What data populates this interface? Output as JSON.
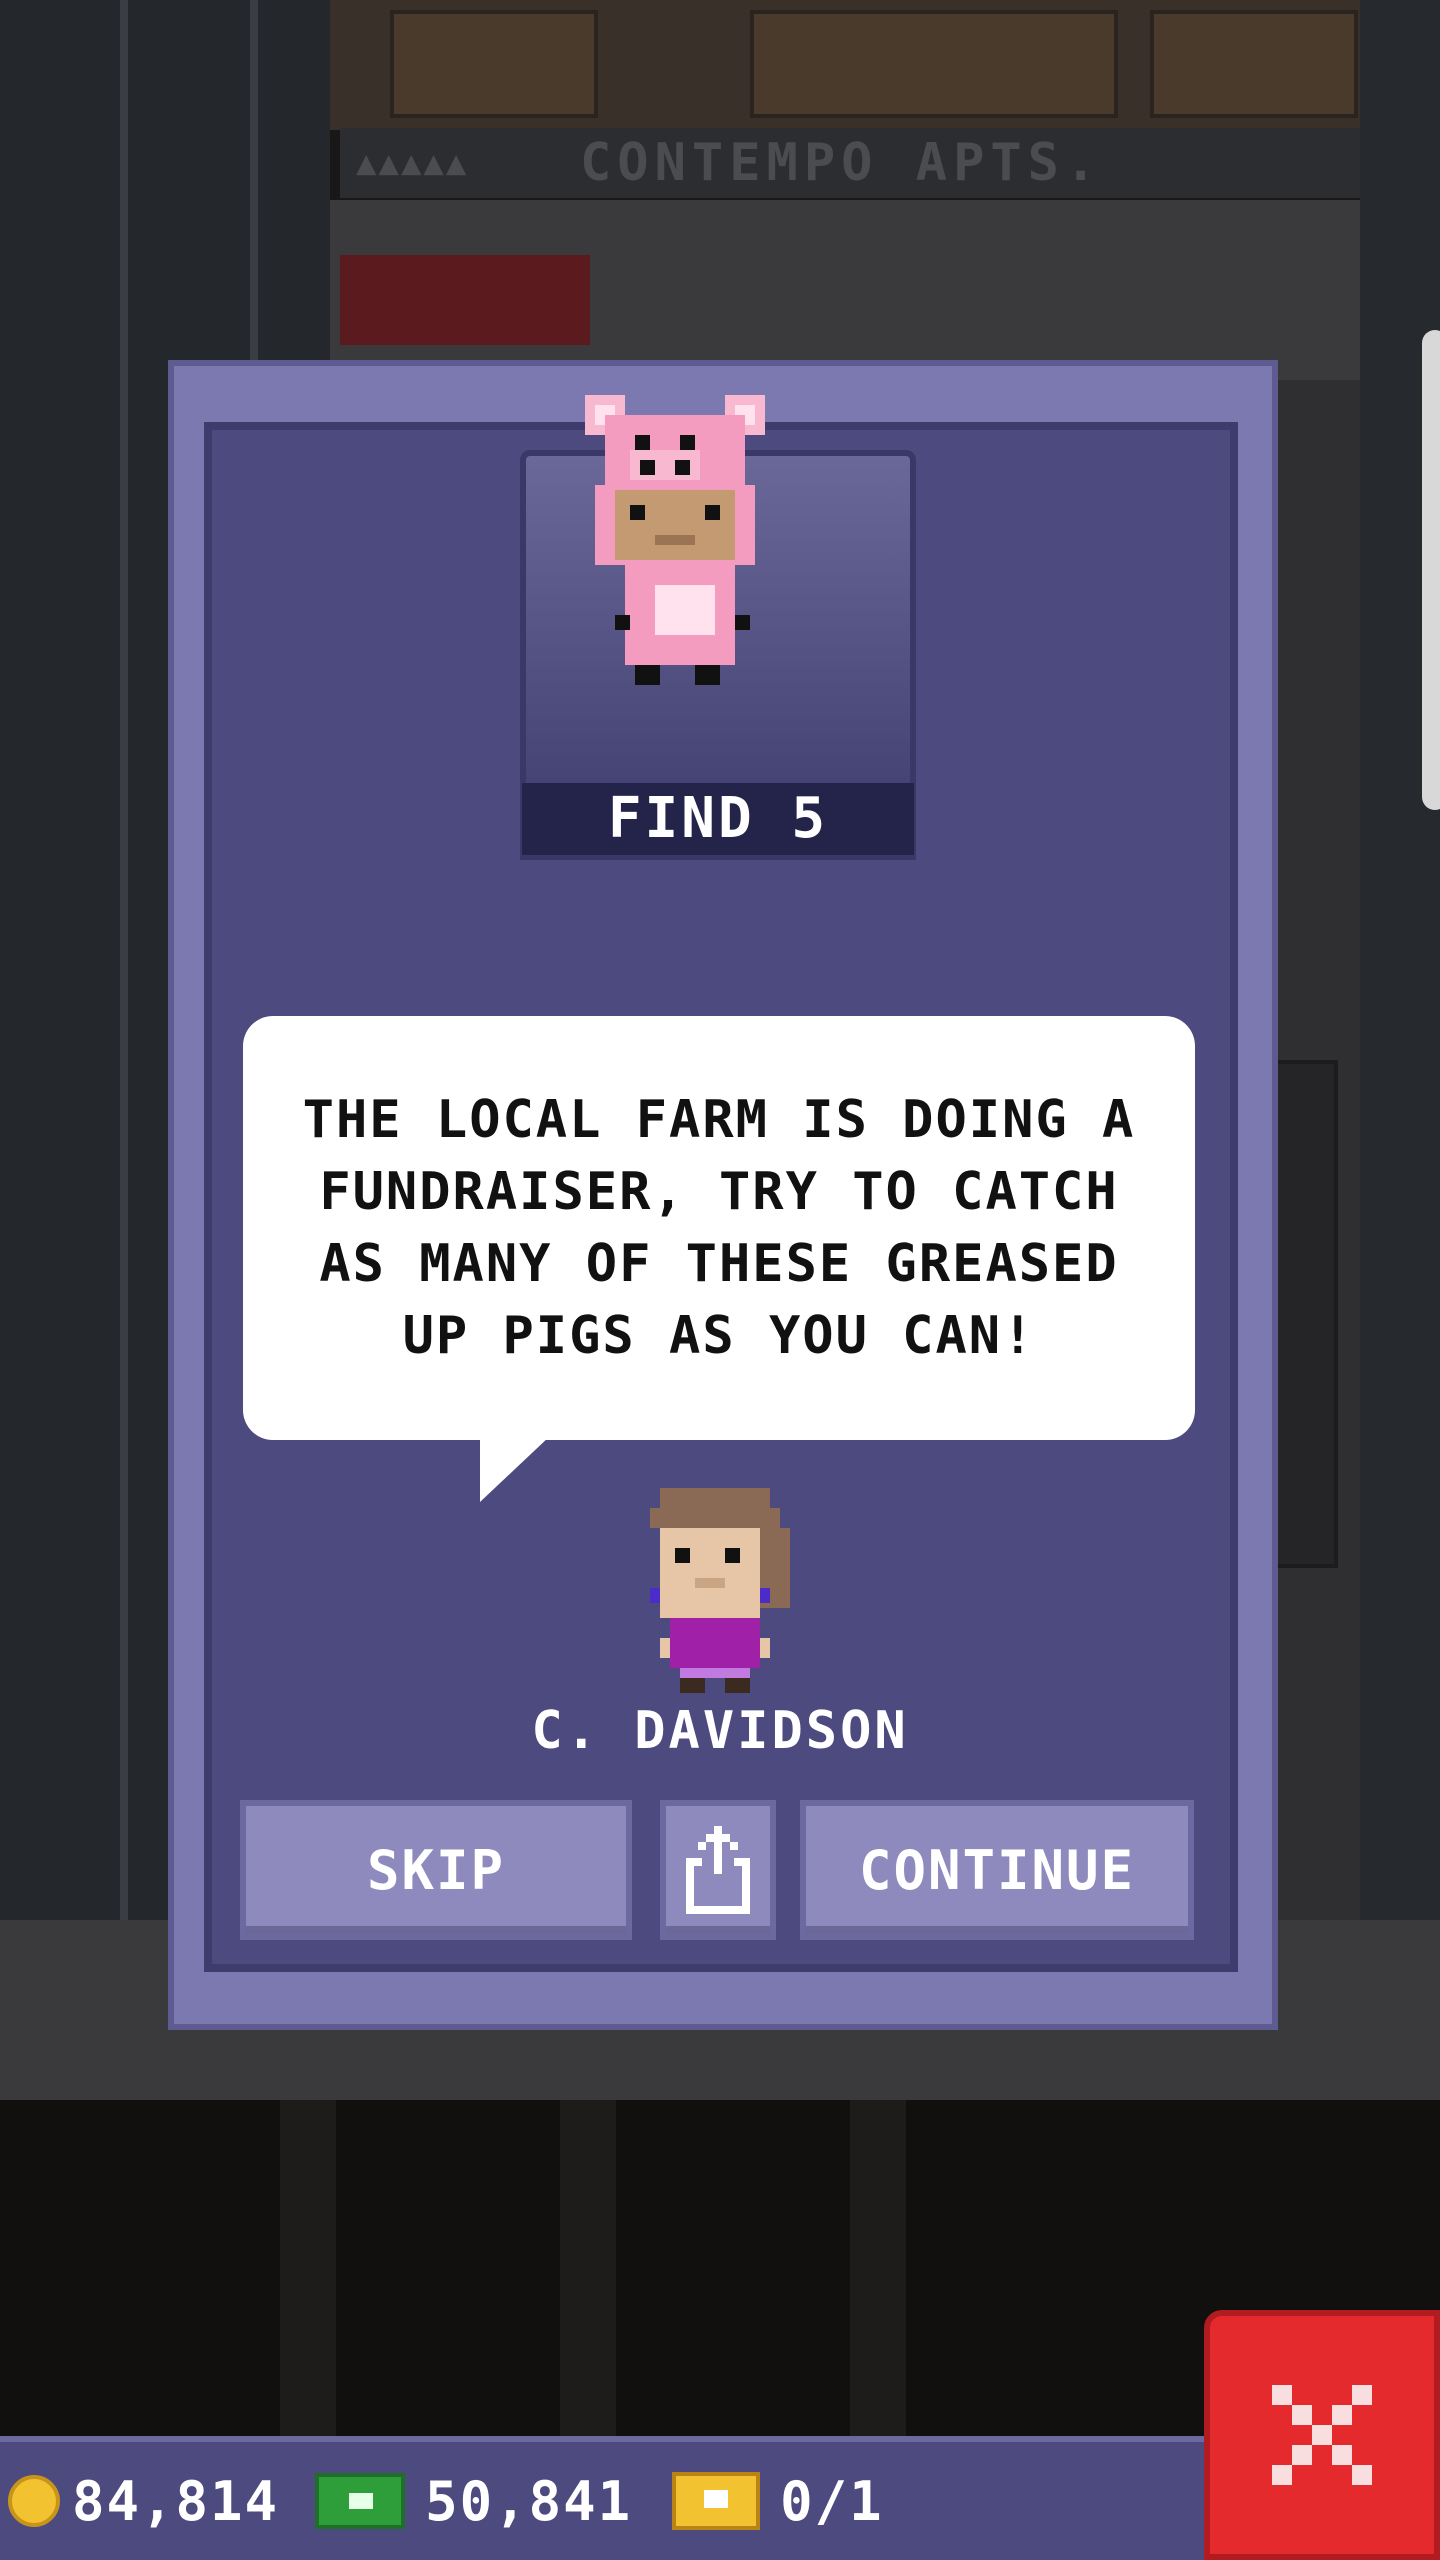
{
  "building": {
    "sign": "CONTEMPO APTS.",
    "sign_dots": "▲▲▲▲▲"
  },
  "mission": {
    "find_label": "FIND 5",
    "message": "THE LOCAL FARM IS DOING A FUNDRAISER, TRY TO CATCH AS MANY OF THESE GREASED UP PIGS AS YOU CAN!",
    "speaker": "C. DAVIDSON",
    "character_icon": "pig-costume-bitizen-icon",
    "speaker_icon": "bitizen-avatar-icon"
  },
  "buttons": {
    "skip": "SKIP",
    "share_icon": "share-icon",
    "continue": "CONTINUE",
    "close_icon": "close-icon"
  },
  "hud": {
    "coins": "84,814",
    "bux": "50,841",
    "tickets": "0/1",
    "coin_icon": "coin-icon",
    "bux_icon": "cash-icon",
    "ticket_icon": "ticket-icon"
  },
  "colors": {
    "dialog": "#7c78b0",
    "dialog_inner": "#4c4a7e",
    "close": "#e52a2e",
    "coin": "#f2c230",
    "bux": "#2e9e3a"
  }
}
